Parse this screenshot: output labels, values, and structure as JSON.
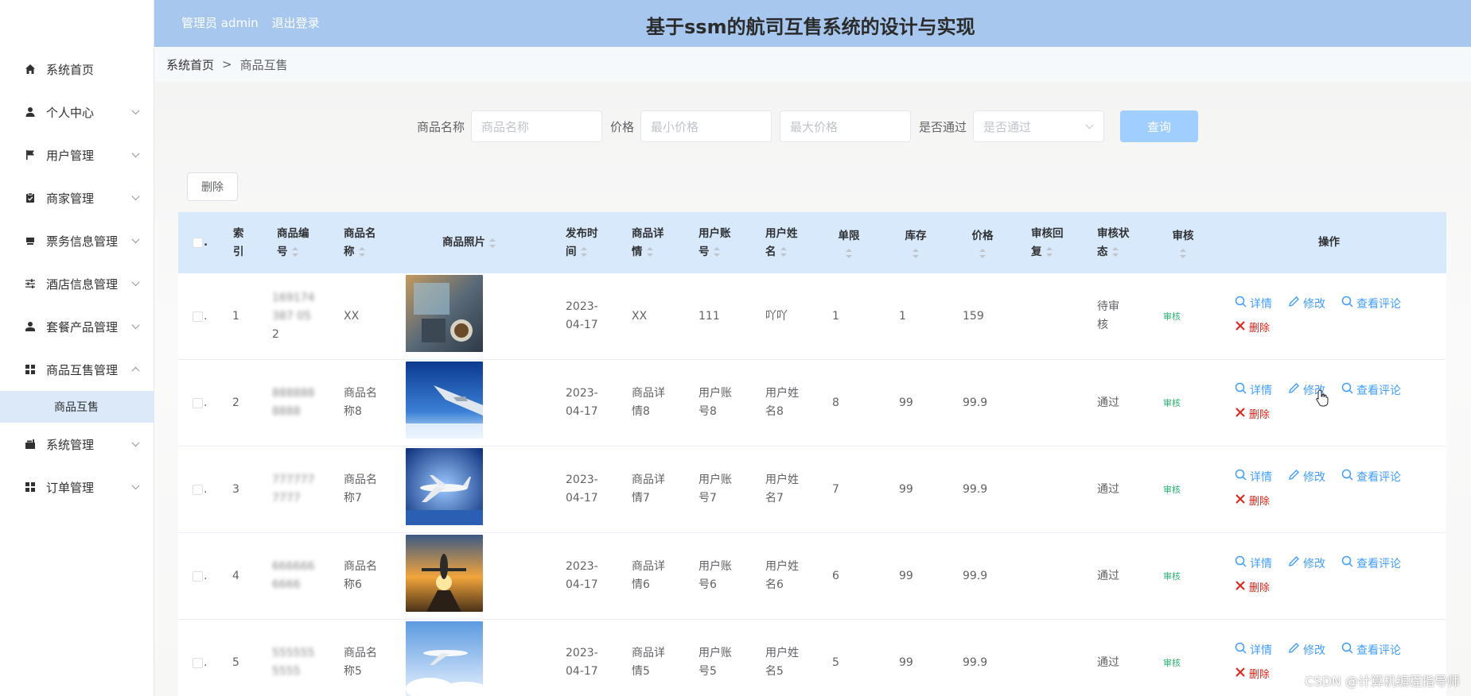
{
  "header": {
    "user_label": "管理员 admin",
    "logout_label": "退出登录",
    "title": "基于ssm的航司互售系统的设计与实现"
  },
  "breadcrumb": {
    "home": "系统首页",
    "separator": ">",
    "current": "商品互售"
  },
  "sidebar": {
    "items": [
      {
        "label": "系统首页",
        "icon": "home-icon",
        "has_arrow": false
      },
      {
        "label": "个人中心",
        "icon": "user-icon",
        "has_arrow": true
      },
      {
        "label": "用户管理",
        "icon": "flag-icon",
        "has_arrow": true
      },
      {
        "label": "商家管理",
        "icon": "clipboard-icon",
        "has_arrow": true
      },
      {
        "label": "票务信息管理",
        "icon": "ticket-icon",
        "has_arrow": true
      },
      {
        "label": "酒店信息管理",
        "icon": "sliders-icon",
        "has_arrow": true
      },
      {
        "label": "套餐产品管理",
        "icon": "person-icon",
        "has_arrow": true
      },
      {
        "label": "商品互售管理",
        "icon": "grid-icon",
        "has_arrow": true,
        "expanded": true
      },
      {
        "label": "系统管理",
        "icon": "folder-icon",
        "has_arrow": true
      },
      {
        "label": "订单管理",
        "icon": "grid-icon",
        "has_arrow": true
      }
    ],
    "submenu_active": "商品互售"
  },
  "search": {
    "name_label": "商品名称",
    "name_placeholder": "商品名称",
    "price_label": "价格",
    "min_placeholder": "最小价格",
    "max_placeholder": "最大价格",
    "pass_label": "是否通过",
    "pass_placeholder": "是否通过",
    "query_label": "查询"
  },
  "toolbar": {
    "delete_label": "删除"
  },
  "table": {
    "headers": {
      "index": "索引",
      "code": "商品编号",
      "name": "商品名称",
      "photo": "商品照片",
      "date": "发布时间",
      "detail": "商品详情",
      "account": "用户账号",
      "username": "用户姓名",
      "limit": "单限",
      "stock": "库存",
      "price": "价格",
      "reply": "审核回复",
      "status": "审核状态",
      "audit": "审核",
      "ops": "操作"
    },
    "rows": [
      {
        "index": "1",
        "code_l1": "169174",
        "code_l2": "387 05",
        "code_l3": "2",
        "name_l1": "XX",
        "name_l2": "",
        "date_l1": "2023-",
        "date_l2": "04-17",
        "detail_l1": "XX",
        "detail_l2": "",
        "account_l1": "111",
        "account_l2": "",
        "user_l1": "吖吖",
        "user_l2": "",
        "limit": "1",
        "stock": "1",
        "price": "159",
        "reply": "",
        "status_l1": "待审",
        "status_l2": "核",
        "audit": "审核",
        "photo": "cafe"
      },
      {
        "index": "2",
        "code_l1": "888888",
        "code_l2": "8888",
        "code_l3": "",
        "name_l1": "商品名",
        "name_l2": "称8",
        "date_l1": "2023-",
        "date_l2": "04-17",
        "detail_l1": "商品详",
        "detail_l2": "情8",
        "account_l1": "用户账",
        "account_l2": "号8",
        "user_l1": "用户姓",
        "user_l2": "名8",
        "limit": "8",
        "stock": "99",
        "price": "99.9",
        "reply": "",
        "status_l1": "通过",
        "status_l2": "",
        "audit": "审核",
        "photo": "wing"
      },
      {
        "index": "3",
        "code_l1": "777777",
        "code_l2": "7777",
        "code_l3": "",
        "name_l1": "商品名",
        "name_l2": "称7",
        "date_l1": "2023-",
        "date_l2": "04-17",
        "detail_l1": "商品详",
        "detail_l2": "情7",
        "account_l1": "用户账",
        "account_l2": "号7",
        "user_l1": "用户姓",
        "user_l2": "名7",
        "limit": "7",
        "stock": "99",
        "price": "99.9",
        "reply": "",
        "status_l1": "通过",
        "status_l2": "",
        "audit": "审核",
        "photo": "plane-blue"
      },
      {
        "index": "4",
        "code_l1": "666666",
        "code_l2": "6666",
        "code_l3": "",
        "name_l1": "商品名",
        "name_l2": "称6",
        "date_l1": "2023-",
        "date_l2": "04-17",
        "detail_l1": "商品详",
        "detail_l2": "情6",
        "account_l1": "用户账",
        "account_l2": "号6",
        "user_l1": "用户姓",
        "user_l2": "名6",
        "limit": "6",
        "stock": "99",
        "price": "99.9",
        "reply": "",
        "status_l1": "通过",
        "status_l2": "",
        "audit": "审核",
        "photo": "sunset"
      },
      {
        "index": "5",
        "code_l1": "555555",
        "code_l2": "5555",
        "code_l3": "",
        "name_l1": "商品名",
        "name_l2": "称5",
        "date_l1": "2023-",
        "date_l2": "04-17",
        "detail_l1": "商品详",
        "detail_l2": "情5",
        "account_l1": "用户账",
        "account_l2": "号5",
        "user_l1": "用户姓",
        "user_l2": "名5",
        "limit": "5",
        "stock": "99",
        "price": "99.9",
        "reply": "",
        "status_l1": "通过",
        "status_l2": "",
        "audit": "审核",
        "photo": "clouds"
      }
    ],
    "ops": {
      "detail": "详情",
      "edit": "修改",
      "comments": "查看评论",
      "delete": "删除"
    }
  },
  "watermark": "CSDN @计算机编程指导师",
  "colors": {
    "header_bg": "#a7c7ee",
    "table_head_bg": "#d8e9fb",
    "primary": "#409eff",
    "danger": "#e2231a",
    "audit_green": "#2bb673"
  }
}
